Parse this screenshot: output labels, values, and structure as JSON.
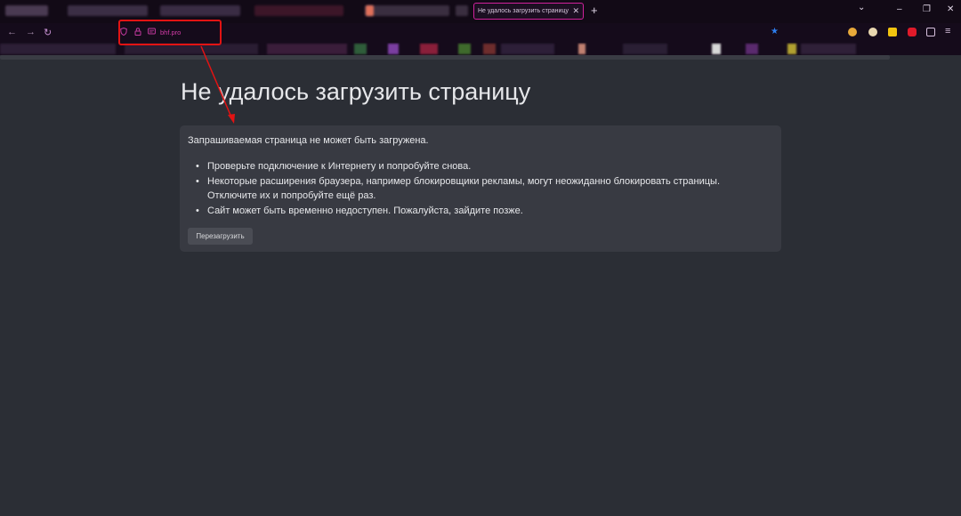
{
  "tabs": {
    "active_title": "Не удалось загрузить страницу | F",
    "close_glyph": "✕",
    "new_tab_glyph": "+"
  },
  "window_controls": {
    "list_tabs_glyph": "⌄",
    "minimize_glyph": "–",
    "restore_glyph": "❐",
    "close_glyph": "✕"
  },
  "navigation": {
    "back_glyph": "←",
    "forward_glyph": "→",
    "reload_glyph": "↻",
    "url": "bhf.pro",
    "bookmark_glyph": "★",
    "menu_glyph": "≡"
  },
  "page": {
    "title": "Не удалось загрузить страницу",
    "message": "Запрашиваемая страница не может быть загружена.",
    "bullets": [
      "Проверьте подключение к Интернету и попробуйте снова.",
      "Некоторые расширения браузера, например блокировщики рекламы, могут неожиданно блокировать страницы. Отключите их и попробуйте ещё раз.",
      "Сайт может быть временно недоступен. Пожалуйста, зайдите позже."
    ],
    "reload_label": "Перезагрузить"
  },
  "colors": {
    "accent": "#d0219c",
    "annotation": "#e21313",
    "page_bg": "#2b2e35",
    "box_bg": "#383a42"
  },
  "icons": {
    "shield": "shield-icon",
    "lock": "lock-icon",
    "permissions": "permissions-icon",
    "extensions": [
      "extension-icon",
      "extension-icon",
      "extension-icon",
      "extension-icon",
      "extensions-puzzle-icon"
    ]
  }
}
